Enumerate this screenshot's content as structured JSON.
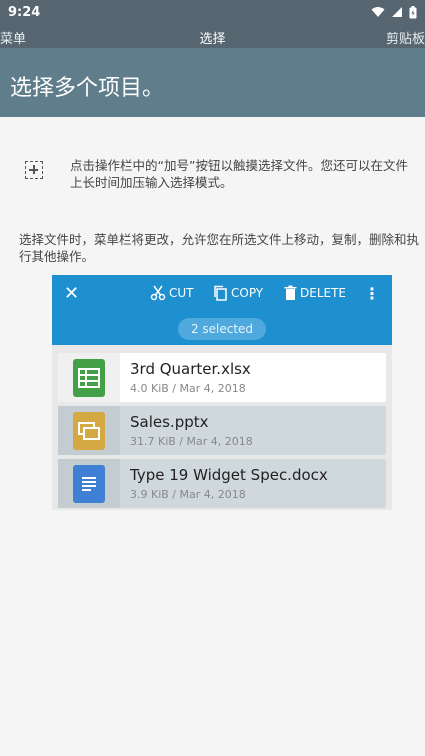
{
  "status_bar": {
    "time": "9:24"
  },
  "nav": {
    "left": "菜单",
    "title": "选择",
    "right": "剪贴板"
  },
  "header": {
    "title": "选择多个项目。"
  },
  "tip": {
    "text": "点击操作栏中的“加号”按钮以触摸选择文件。您还可以在文件上长时间加压输入选择模式。"
  },
  "description": {
    "text": "选择文件时，菜单栏将更改，允许您在所选文件上移动，复制，删除和执行其他操作。"
  },
  "demo": {
    "actions": {
      "cut": "CUT",
      "copy": "COPY",
      "delete": "DELETE"
    },
    "selected_label": "2 selected",
    "files": [
      {
        "name": "3rd Quarter.xlsx",
        "meta": "4.0 KiB / Mar 4, 2018",
        "selected": false,
        "color": "#43a047",
        "icon": "spreadsheet-icon"
      },
      {
        "name": "Sales.pptx",
        "meta": "31.7 KiB / Mar 4, 2018",
        "selected": true,
        "color": "#d4a843",
        "icon": "presentation-icon"
      },
      {
        "name": "Type 19 Widget Spec.docx",
        "meta": "3.9 KiB / Mar 4, 2018",
        "selected": true,
        "color": "#3f7fd4",
        "icon": "document-icon"
      }
    ]
  },
  "colors": {
    "status_bar": "#56656f",
    "header": "#607d8b",
    "toolbar": "#1e8fcf"
  }
}
